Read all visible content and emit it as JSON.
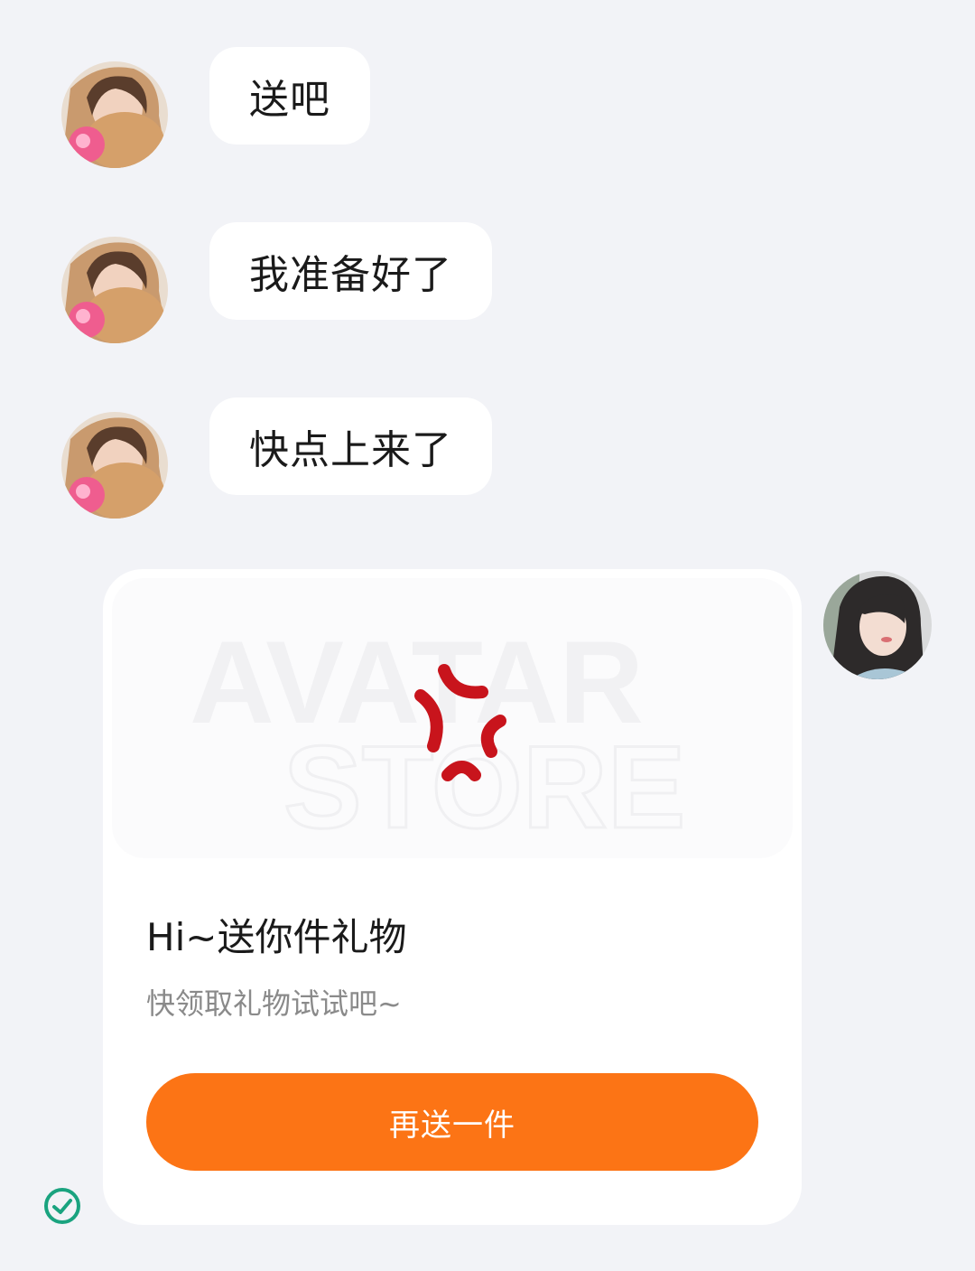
{
  "messages": [
    {
      "sender": "other",
      "text": "送吧"
    },
    {
      "sender": "other",
      "text": "我准备好了"
    },
    {
      "sender": "other",
      "text": "快点上来了"
    }
  ],
  "gift_card": {
    "image_watermark_line1": "AVATAR",
    "image_watermark_line2": "STORE",
    "image_icon": "anger-symbol-icon",
    "title": "Hi~送你件礼物",
    "subtitle": "快领取礼物试试吧~",
    "button_label": "再送一件"
  },
  "status": {
    "read_icon": "check-circle-icon"
  },
  "colors": {
    "background": "#f2f3f7",
    "bubble": "#ffffff",
    "accent_orange": "#fc7415",
    "anger_red": "#c8141c",
    "check_green": "#1aa37f",
    "subtitle_gray": "#8a8a8a"
  }
}
